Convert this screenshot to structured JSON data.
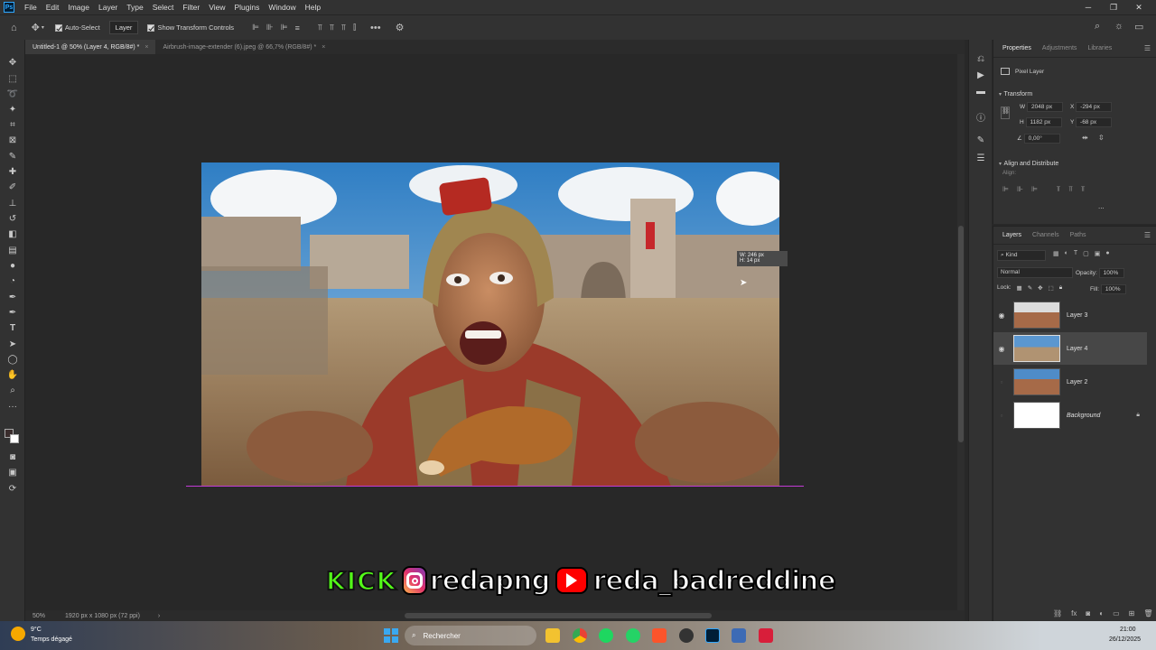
{
  "app": {
    "logo": "Ps"
  },
  "menu": [
    "File",
    "Edit",
    "Image",
    "Layer",
    "Type",
    "Select",
    "Filter",
    "View",
    "Plugins",
    "Window",
    "Help"
  ],
  "options": {
    "auto_select": "Auto-Select",
    "layer_dropdown": "Layer",
    "show_transform": "Show Transform Controls"
  },
  "tabs": [
    {
      "label": "Untitled-1 @ 50% (Layer 4, RGB/8#) *",
      "active": true
    },
    {
      "label": "Airbrush-image-extender (6).jpeg @ 66,7% (RGB/8#) *",
      "active": false
    }
  ],
  "transform_hud": {
    "w": "246 px",
    "h": "14 px"
  },
  "status": {
    "zoom": "50%",
    "doc_info": "1920 px x 1080 px (72 ppi)"
  },
  "properties": {
    "tabs": [
      "Properties",
      "Adjustments",
      "Libraries"
    ],
    "kind": "Pixel Layer",
    "transform_title": "Transform",
    "w_label": "W",
    "w_value": "2048 px",
    "h_label": "H",
    "h_value": "1182 px",
    "x_label": "X",
    "x_value": "-294 px",
    "y_label": "Y",
    "y_value": "-68 px",
    "angle_value": "0,00°",
    "align_title": "Align and Distribute",
    "align_label": "Align:",
    "more": "..."
  },
  "layers_panel": {
    "tabs": [
      "Layers",
      "Channels",
      "Paths"
    ],
    "kind_filter": "Kind",
    "blend_mode": "Normal",
    "opacity_label": "Opacity:",
    "opacity_value": "100%",
    "lock_label": "Lock:",
    "fill_label": "Fill:",
    "fill_value": "100%",
    "items": [
      {
        "name": "Layer 3",
        "visible": true,
        "selected": false
      },
      {
        "name": "Layer 4",
        "visible": true,
        "selected": true
      },
      {
        "name": "Layer 2",
        "visible": false,
        "selected": false
      },
      {
        "name": "Background",
        "visible": false,
        "selected": false
      }
    ]
  },
  "banner": {
    "kick": "KICK",
    "handle1": "redapng",
    "handle2": "reda_badreddine"
  },
  "taskbar": {
    "weather_temp": "9°C",
    "weather_desc": "Temps dégagé",
    "search_placeholder": "Rechercher",
    "time": "21:00",
    "date": "26/12/2025"
  },
  "colors": {
    "kick": "#53fc18",
    "youtube": "#ff0000",
    "ps_blue": "#31a8ff"
  }
}
